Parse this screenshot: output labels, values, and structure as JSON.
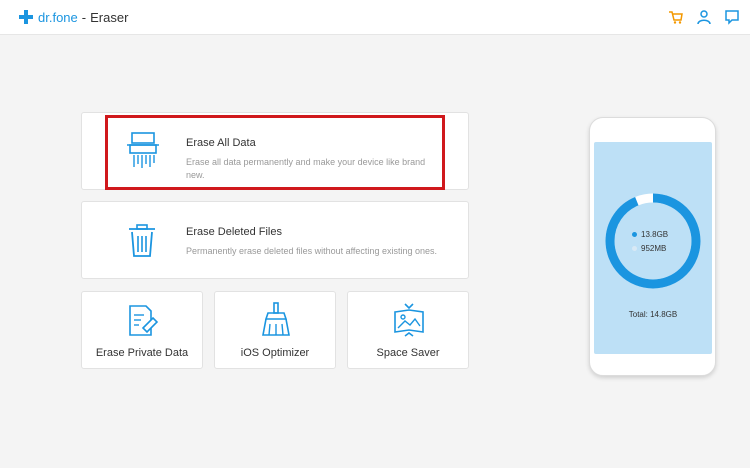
{
  "app": {
    "brand": "dr.fone",
    "separator": "-",
    "module": "Eraser"
  },
  "topbar": {
    "icons": [
      "cart-icon",
      "user-icon",
      "feedback-icon"
    ],
    "accent": "#1b95e0",
    "cart_color": "#f39800"
  },
  "options": {
    "erase_all": {
      "title": "Erase All Data",
      "desc_line1": "Erase all data permanently and make your device like brand",
      "desc_line2": "new."
    },
    "erase_deleted": {
      "title": "Erase Deleted Files",
      "desc": "Permanently erase deleted files without affecting existing ones."
    },
    "erase_private": {
      "label": "Erase Private Data"
    },
    "ios_optimizer": {
      "label": "iOS Optimizer"
    },
    "space_saver": {
      "label": "Space Saver"
    }
  },
  "device": {
    "used": "13.8GB",
    "free": "952MB",
    "total": "Total: 14.8GB",
    "used_fraction": 0.937,
    "used_color": "#1b95e0",
    "free_color": "#ffffff"
  },
  "highlight_color": "#d0181c"
}
